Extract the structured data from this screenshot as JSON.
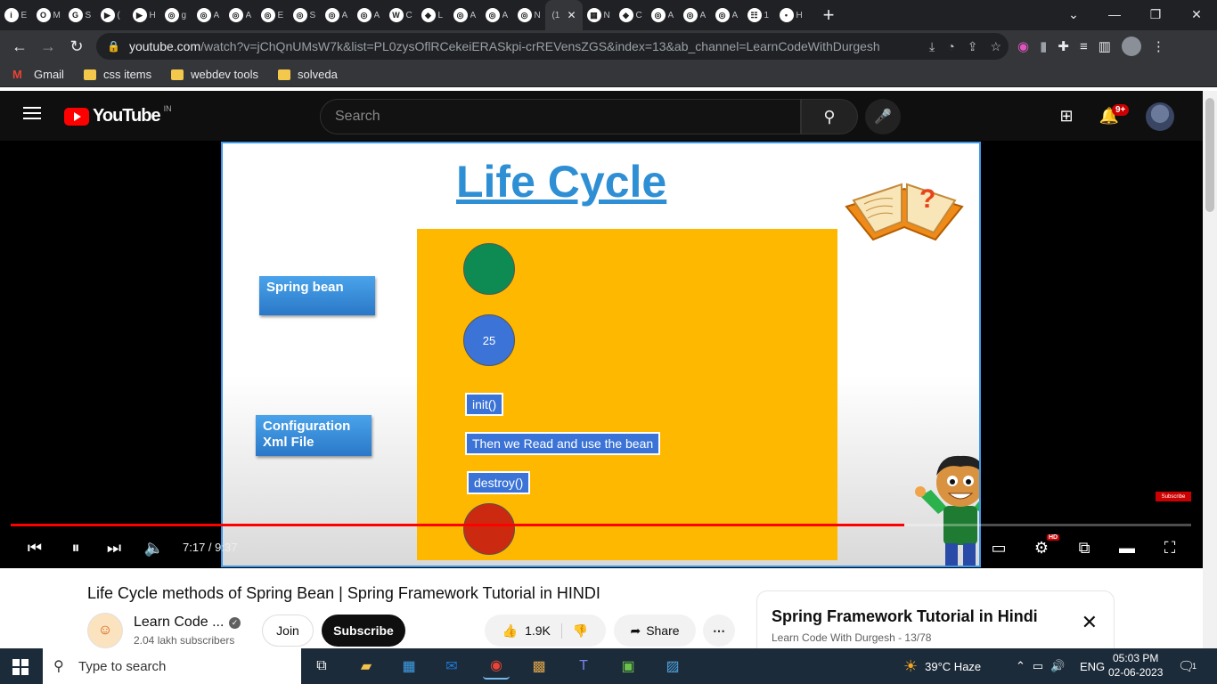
{
  "browser": {
    "tabs": [
      {
        "label": "E",
        "icon": "i"
      },
      {
        "label": "M",
        "icon": "O"
      },
      {
        "label": "S",
        "icon": "G"
      },
      {
        "label": "(",
        "icon": "▶"
      },
      {
        "label": "H",
        "icon": "▶"
      },
      {
        "label": "g",
        "icon": "◎"
      },
      {
        "label": "A",
        "icon": "◎"
      },
      {
        "label": "A",
        "icon": "◎"
      },
      {
        "label": "E",
        "icon": "◎"
      },
      {
        "label": "S",
        "icon": "◎"
      },
      {
        "label": "A",
        "icon": "◎"
      },
      {
        "label": "A",
        "icon": "◎"
      },
      {
        "label": "C",
        "icon": "W"
      },
      {
        "label": "L",
        "icon": "◆"
      },
      {
        "label": "A",
        "icon": "◎"
      },
      {
        "label": "A",
        "icon": "◎"
      },
      {
        "label": "N",
        "icon": "◎"
      }
    ],
    "active_tab_label": "(1",
    "tabs_after": [
      {
        "label": "N",
        "icon": "▦"
      },
      {
        "label": "C",
        "icon": "◆"
      },
      {
        "label": "A",
        "icon": "◎"
      },
      {
        "label": "A",
        "icon": "◎"
      },
      {
        "label": "A",
        "icon": "◎"
      },
      {
        "label": "1",
        "icon": "☷"
      },
      {
        "label": "H",
        "icon": "•"
      }
    ],
    "url_host": "youtube.com",
    "url_path": "/watch?v=jChQnUMsW7k&list=PL0zysOflRCekeiERASkpi-crREVensZGS&index=13&ab_channel=LearnCodeWithDurgesh",
    "bookmarks": [
      "Gmail",
      "css items",
      "webdev tools",
      "solveda"
    ]
  },
  "youtube": {
    "logo_text": "YouTube",
    "country_code": "IN",
    "search_placeholder": "Search",
    "notification_count": "9+"
  },
  "slide": {
    "title": "Life Cycle",
    "left_box_1": "Spring bean",
    "left_box_2_line1": "Configuration",
    "left_box_2_line2": "Xml File",
    "blue_circle_value": "25",
    "step_init": "init()",
    "step_use": "Then we Read and use the bean",
    "step_destroy": "destroy()",
    "watermark": "Subscribe"
  },
  "player": {
    "current_time": "7:17",
    "duration": "9:37",
    "progress_fraction": 0.757,
    "quality_badge": "HD"
  },
  "video": {
    "title": "Life Cycle methods of Spring Bean | Spring Framework Tutorial in HINDI",
    "channel_name": "Learn Code ...",
    "subscribers": "2.04 lakh subscribers",
    "join_label": "Join",
    "subscribe_label": "Subscribe",
    "likes": "1.9K",
    "share_label": "Share"
  },
  "playlist": {
    "title": "Spring Framework Tutorial in Hindi",
    "subtitle": "Learn Code With Durgesh - 13/78"
  },
  "taskbar": {
    "search_placeholder": "Type to search",
    "weather": "39°C  Haze",
    "language": "ENG",
    "time": "05:03 PM",
    "date": "02-06-2023",
    "notification_count": "1"
  },
  "colors": {
    "youtube_red": "#ff0000",
    "slide_title_blue": "#2e8fd4",
    "slide_orange": "#ffb800",
    "taskbar_bg": "#1c2b3a"
  }
}
